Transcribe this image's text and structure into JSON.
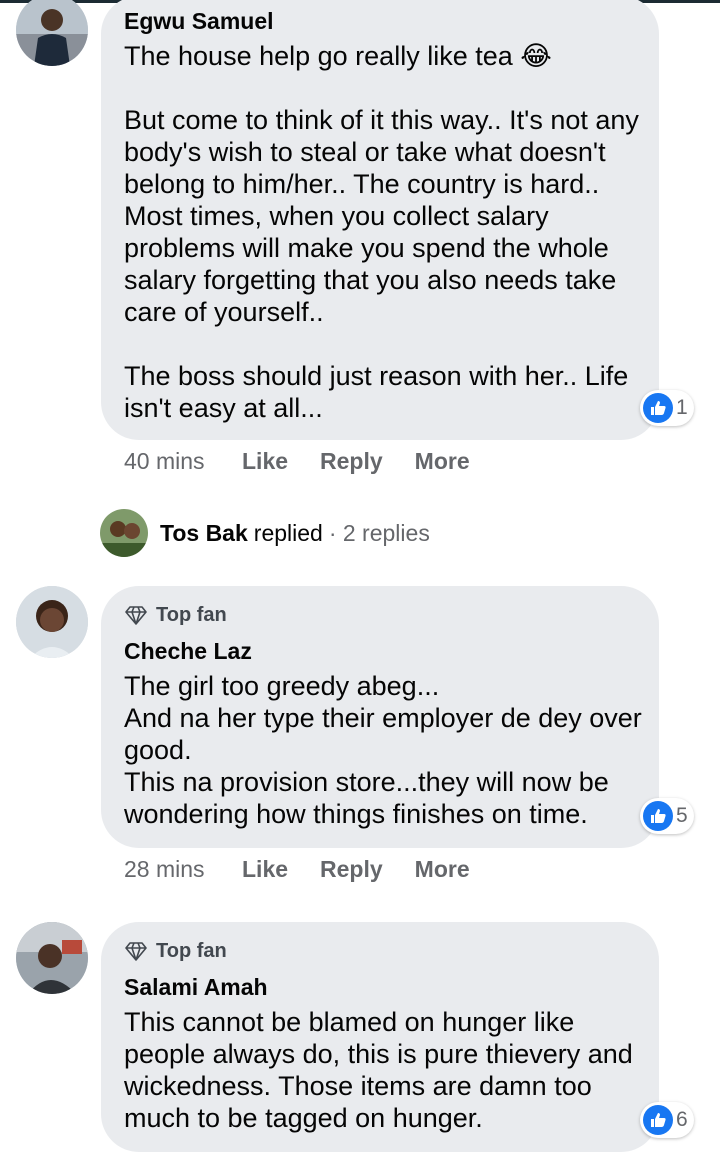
{
  "colors": {
    "bubble": "#e9ebee",
    "like_blue": "#1877f2",
    "meta_gray": "#65676b"
  },
  "comments": [
    {
      "name": "Egwu Samuel",
      "top_fan": "",
      "text": "The house help go really like tea 😂\n\nBut come to think of it this way.. It's not any body's wish to steal or take what doesn't belong to him/her.. The country is hard.. Most times, when you collect salary problems will make you spend the whole salary forgetting that you also needs take care of yourself..\n\nThe boss should just reason with her.. Life isn't easy at all...",
      "reaction_icon": "like-icon",
      "reaction_count": "1",
      "time": "40 mins",
      "actions": [
        "Like",
        "Reply",
        "More"
      ]
    },
    {
      "name": "Cheche Laz",
      "top_fan": "Top fan",
      "text": "The girl too greedy abeg...\nAnd na her type their employer de dey over good.\nThis na provision store...they will now be wondering how things finishes on time.",
      "reaction_icon": "like-icon",
      "reaction_count": "5",
      "time": "28 mins",
      "actions": [
        "Like",
        "Reply",
        "More"
      ]
    },
    {
      "name": "Salami Amah",
      "top_fan": "Top fan",
      "text": "This cannot be blamed on hunger like people always do, this is pure thievery and wickedness. Those items are damn too much to be tagged on hunger.",
      "reaction_icon": "like-icon",
      "reaction_count": "6"
    }
  ],
  "replies_row": {
    "name": "Tos Bak",
    "word": "replied",
    "count": "· 2 replies"
  }
}
